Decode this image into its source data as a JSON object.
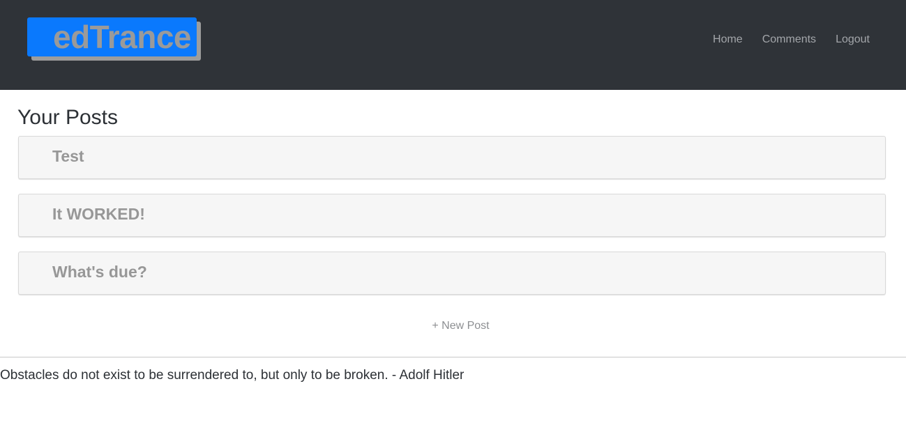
{
  "navbar": {
    "brand": "edTrance",
    "links": [
      "Home",
      "Comments",
      "Logout"
    ]
  },
  "main": {
    "title": "Your Posts",
    "posts": [
      "Test",
      "It WORKED!",
      "What's due?"
    ],
    "new_post_label": "+ New Post"
  },
  "footer": {
    "quote": "Obstacles do not exist to be surrendered to, but only to be broken. - Adolf Hitler"
  },
  "colors": {
    "navbar_bg": "#2f3338",
    "brand_bg": "#0a79fd",
    "brand_text": "#9a9a9a",
    "card_bg": "#f6f6f6"
  }
}
